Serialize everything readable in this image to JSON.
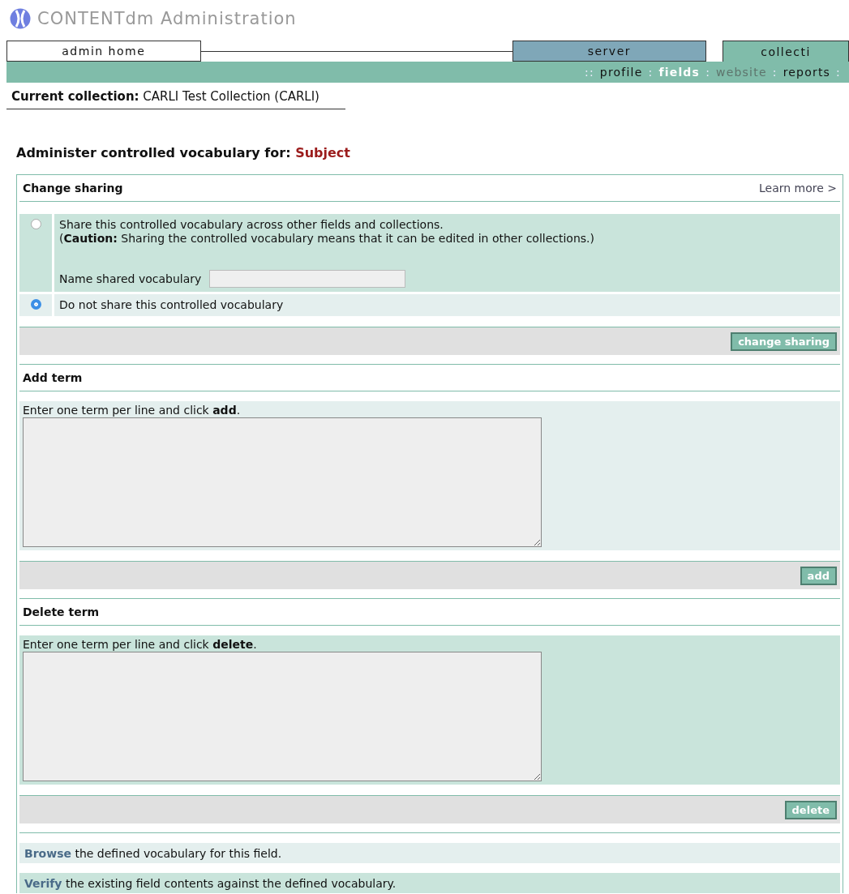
{
  "header": {
    "title": "CONTENTdm Administration"
  },
  "tabs": [
    {
      "label": "admin home",
      "color": "#ffffff",
      "selected": false
    },
    {
      "label": "server",
      "color": "#7fa7b8",
      "selected": false
    },
    {
      "label": "collecti",
      "color": "#80bcaa",
      "selected": true
    }
  ],
  "subnav": {
    "prefix": "::",
    "separator": ":",
    "items": [
      {
        "label": "profile",
        "selected": false,
        "disabled": false
      },
      {
        "label": "fields",
        "selected": true,
        "disabled": false
      },
      {
        "label": "website",
        "selected": false,
        "disabled": true
      },
      {
        "label": "reports",
        "selected": false,
        "disabled": false
      }
    ],
    "trailing": ":"
  },
  "current_collection": {
    "label": "Current collection:",
    "value": "CARLI Test Collection (CARLI)"
  },
  "heading": {
    "label": "Administer controlled vocabulary for:",
    "field": "Subject"
  },
  "change_sharing": {
    "title": "Change sharing",
    "learn_more": "Learn more >",
    "options": [
      {
        "text": "Share this controlled vocabulary across other fields and collections.",
        "note": "(**Caution:** Sharing the controlled vocabulary means that it can be edited in other collections.)",
        "name_label": "Name shared vocabulary",
        "selected": false
      },
      {
        "text": "Do not share this controlled vocabulary",
        "selected": true
      }
    ],
    "button": "change sharing"
  },
  "add_term": {
    "title": "Add term",
    "instruction": "Enter one term per line and click **add**.",
    "button": "add"
  },
  "delete_term": {
    "title": "Delete term",
    "instruction": "Enter one term per line and click **delete**.",
    "button": "delete"
  },
  "links": [
    {
      "link": "Browse",
      "text": " the defined vocabulary for this field."
    },
    {
      "link": "Verify",
      "text": " the existing field contents against the defined vocabulary."
    }
  ]
}
